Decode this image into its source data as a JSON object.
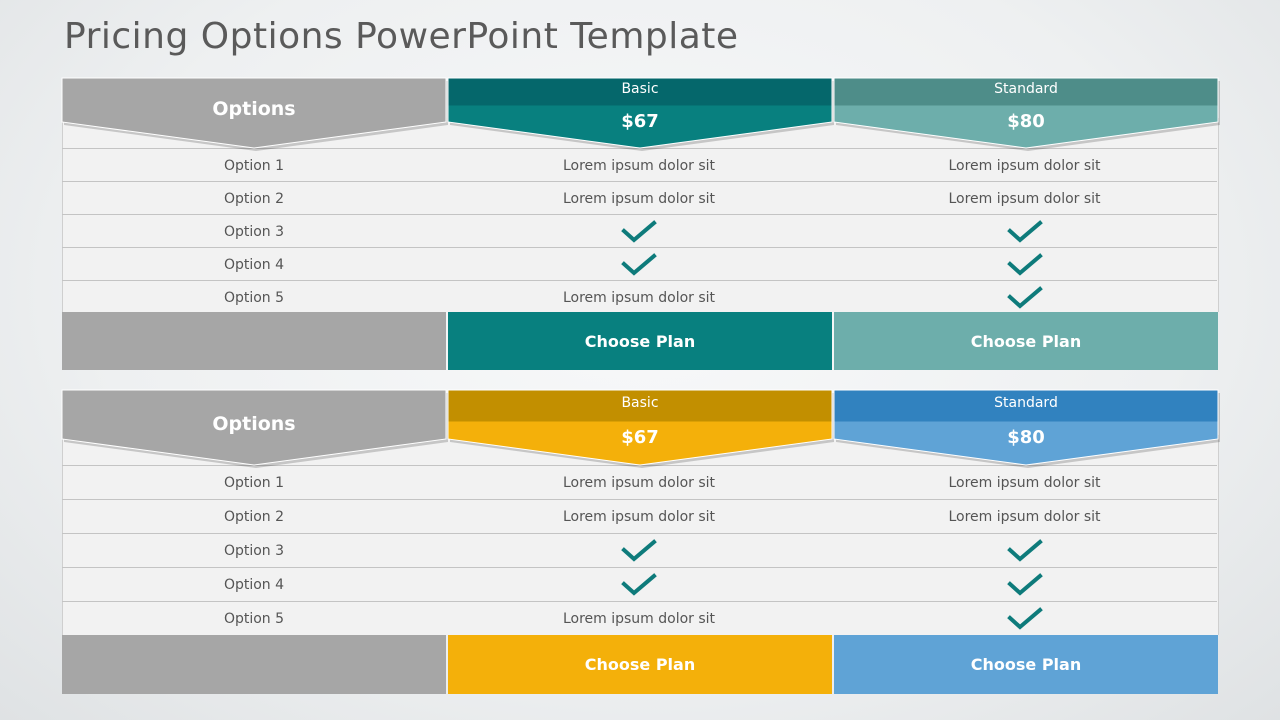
{
  "title": "Pricing Options PowerPoint Template",
  "tables": [
    {
      "options_header": "Options",
      "plans": [
        {
          "name": "Basic",
          "price": "$67",
          "button": "Choose Plan",
          "top_color": "#05676b",
          "bottom_color": "#08807f",
          "button_color": "#08807f"
        },
        {
          "name": "Standard",
          "price": "$80",
          "button": "Choose Plan",
          "top_color": "#4e8d89",
          "bottom_color": "#6daeab",
          "button_color": "#6daeab"
        }
      ],
      "rows": [
        {
          "label": "Option 1",
          "values": [
            "Lorem ipsum dolor sit",
            "Lorem ipsum dolor sit"
          ]
        },
        {
          "label": "Option 2",
          "values": [
            "Lorem ipsum dolor sit",
            "Lorem ipsum dolor sit"
          ]
        },
        {
          "label": "Option 3",
          "values": [
            "check",
            "check"
          ]
        },
        {
          "label": "Option 4",
          "values": [
            "check",
            "check"
          ]
        },
        {
          "label": "Option 5",
          "values": [
            "Lorem ipsum dolor sit",
            "check"
          ]
        }
      ]
    },
    {
      "options_header": "Options",
      "plans": [
        {
          "name": "Basic",
          "price": "$67",
          "button": "Choose Plan",
          "top_color": "#c28f00",
          "bottom_color": "#f4b00a",
          "button_color": "#f4b00a"
        },
        {
          "name": "Standard",
          "price": "$80",
          "button": "Choose Plan",
          "top_color": "#3182bf",
          "bottom_color": "#5fa3d6",
          "button_color": "#5fa3d6"
        }
      ],
      "rows": [
        {
          "label": "Option 1",
          "values": [
            "Lorem ipsum dolor sit",
            "Lorem ipsum dolor sit"
          ]
        },
        {
          "label": "Option 2",
          "values": [
            "Lorem ipsum dolor sit",
            "Lorem ipsum dolor sit"
          ]
        },
        {
          "label": "Option 3",
          "values": [
            "check",
            "check"
          ]
        },
        {
          "label": "Option 4",
          "values": [
            "check",
            "check"
          ]
        },
        {
          "label": "Option 5",
          "values": [
            "Lorem ipsum dolor sit",
            "check"
          ]
        }
      ]
    }
  ],
  "colors": {
    "options_header": "#a6a6a6",
    "footer_blank": "#a6a6a6",
    "check": "#0e7b7b",
    "row_bg": "#f2f2f2"
  }
}
